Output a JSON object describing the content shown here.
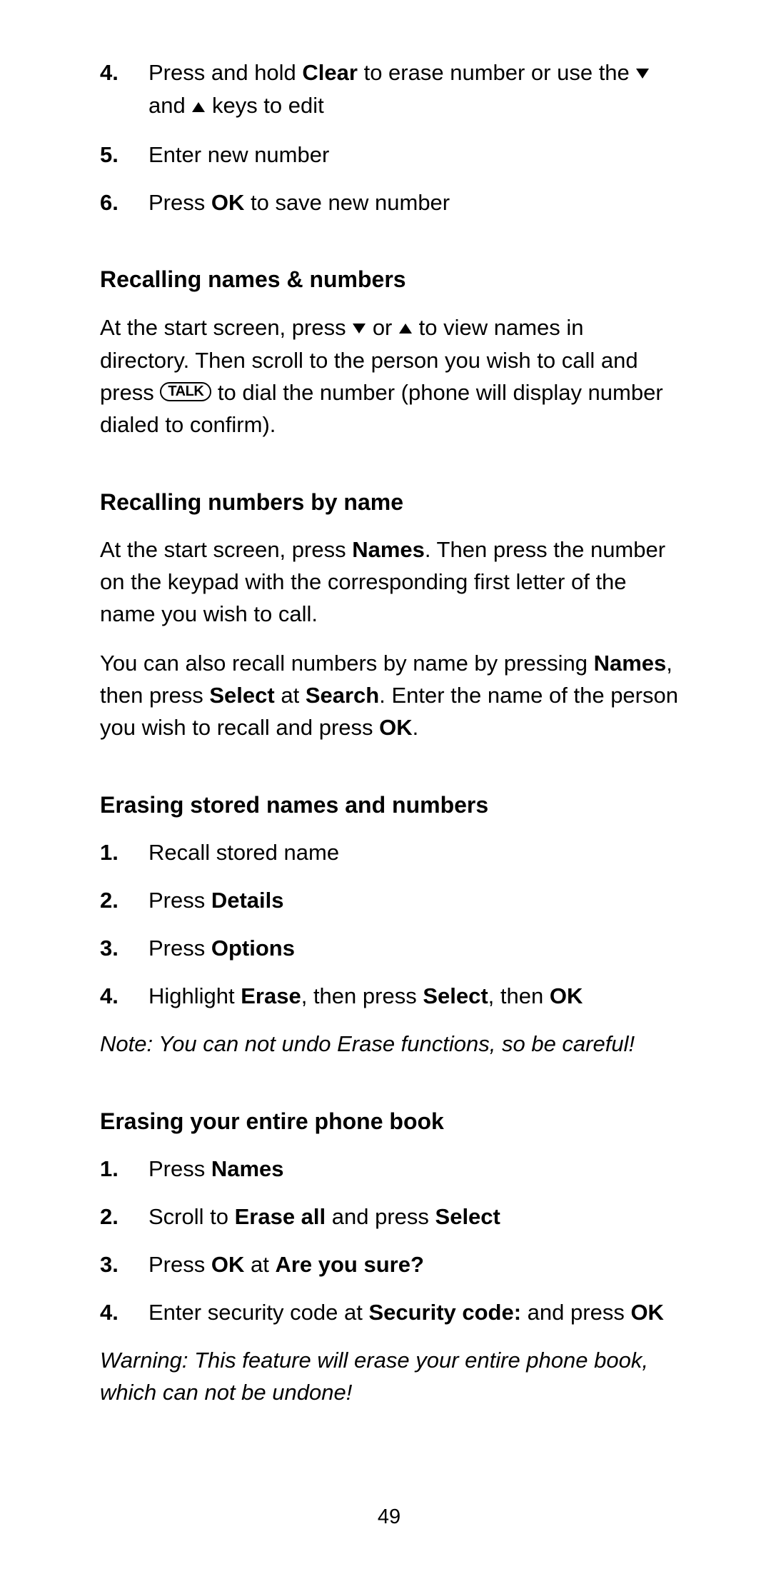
{
  "list1": {
    "items": [
      {
        "num": "4.",
        "parts": [
          {
            "t": "Press and hold "
          },
          {
            "t": "Clear",
            "bold": true
          },
          {
            "t": " to erase number or use the "
          },
          {
            "icon": "down"
          },
          {
            "t": " and "
          },
          {
            "icon": "up"
          },
          {
            "t": " keys to edit"
          }
        ]
      },
      {
        "num": "5.",
        "parts": [
          {
            "t": "Enter new number"
          }
        ]
      },
      {
        "num": "6.",
        "parts": [
          {
            "t": "Press "
          },
          {
            "t": "OK",
            "bold": true
          },
          {
            "t": " to save new number"
          }
        ]
      }
    ]
  },
  "section2": {
    "heading": "Recalling names & numbers",
    "para1_parts": [
      {
        "t": "At the start screen, press "
      },
      {
        "icon": "down"
      },
      {
        "t": " or "
      },
      {
        "icon": "up"
      },
      {
        "t": " to view names in directory. Then scroll to the person you wish to call and press "
      },
      {
        "icon": "talk"
      },
      {
        "t": " to dial the number (phone will display number dialed to confirm)."
      }
    ]
  },
  "section3": {
    "heading": "Recalling numbers by name",
    "para1_parts": [
      {
        "t": "At the start screen, press "
      },
      {
        "t": "Names",
        "bold": true
      },
      {
        "t": ". Then press the number on the keypad with the corresponding first letter of the name you wish to call."
      }
    ],
    "para2_parts": [
      {
        "t": "You can also recall numbers by name by pressing "
      },
      {
        "t": "Names",
        "bold": true
      },
      {
        "t": ", then press "
      },
      {
        "t": "Select",
        "bold": true
      },
      {
        "t": " at "
      },
      {
        "t": "Search",
        "bold": true
      },
      {
        "t": ". Enter the name of the person you wish to recall and press "
      },
      {
        "t": "OK",
        "bold": true
      },
      {
        "t": "."
      }
    ]
  },
  "section4": {
    "heading": "Erasing stored names and numbers",
    "items": [
      {
        "num": "1.",
        "parts": [
          {
            "t": "Recall stored name"
          }
        ]
      },
      {
        "num": "2.",
        "parts": [
          {
            "t": "Press "
          },
          {
            "t": "Details",
            "bold": true
          }
        ]
      },
      {
        "num": "3.",
        "parts": [
          {
            "t": "Press "
          },
          {
            "t": "Options",
            "bold": true
          }
        ]
      },
      {
        "num": "4.",
        "parts": [
          {
            "t": "Highlight "
          },
          {
            "t": "Erase",
            "bold": true
          },
          {
            "t": ", then press "
          },
          {
            "t": "Select",
            "bold": true
          },
          {
            "t": ", then "
          },
          {
            "t": "OK",
            "bold": true
          }
        ]
      }
    ],
    "note": "Note: You can not undo Erase functions, so be careful!"
  },
  "section5": {
    "heading": "Erasing your entire phone book",
    "items": [
      {
        "num": "1.",
        "parts": [
          {
            "t": "Press "
          },
          {
            "t": "Names",
            "bold": true
          }
        ]
      },
      {
        "num": "2.",
        "parts": [
          {
            "t": "Scroll to "
          },
          {
            "t": "Erase all",
            "bold": true
          },
          {
            "t": " and press "
          },
          {
            "t": "Select",
            "bold": true
          }
        ]
      },
      {
        "num": "3.",
        "parts": [
          {
            "t": "Press "
          },
          {
            "t": "OK",
            "bold": true
          },
          {
            "t": " at "
          },
          {
            "t": "Are you sure?",
            "bold": true
          }
        ]
      },
      {
        "num": "4.",
        "parts": [
          {
            "t": "Enter security code at "
          },
          {
            "t": "Security code:",
            "bold": true
          },
          {
            "t": " and press "
          },
          {
            "t": "OK",
            "bold": true
          }
        ]
      }
    ],
    "note": "Warning: This feature will erase your entire phone book, which can not be undone!"
  },
  "talk_label": "TALK",
  "page_number": "49"
}
